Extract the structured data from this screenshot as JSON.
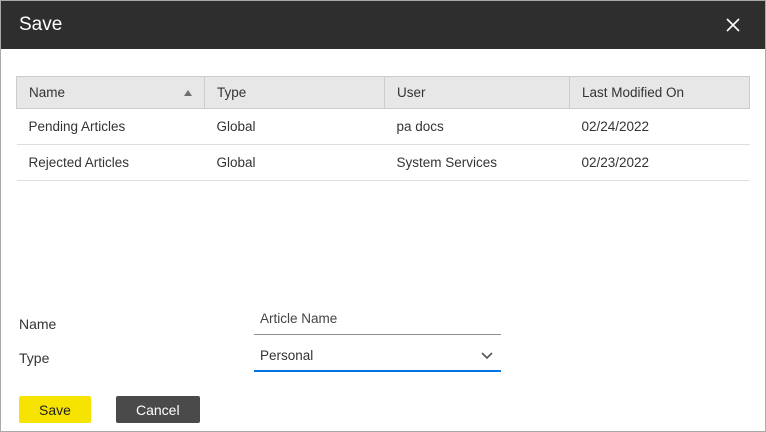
{
  "dialog": {
    "title": "Save"
  },
  "table": {
    "columns": [
      "Name",
      "Type",
      "User",
      "Last Modified On"
    ],
    "sort": {
      "column": "Name",
      "direction": "ascending"
    },
    "rows": [
      {
        "name": "Pending Articles",
        "type": "Global",
        "user": "pa docs",
        "modified": "02/24/2022"
      },
      {
        "name": "Rejected Articles",
        "type": "Global",
        "user": "System Services",
        "modified": "02/23/2022"
      }
    ]
  },
  "form": {
    "name_label": "Name",
    "name_value": "Article Name",
    "type_label": "Type",
    "type_value": "Personal"
  },
  "buttons": {
    "save_label": "Save",
    "cancel_label": "Cancel"
  },
  "icons": {
    "close": "close-icon",
    "sort": "sort-ascending-icon",
    "chevron": "chevron-down-icon"
  },
  "colors": {
    "titlebar_bg": "#2e2e2e",
    "table_header_bg": "#e7e7e7",
    "save_button_bg": "#f7e300",
    "cancel_button_bg": "#4a4a4a",
    "select_focus_underline": "#0073e6"
  }
}
